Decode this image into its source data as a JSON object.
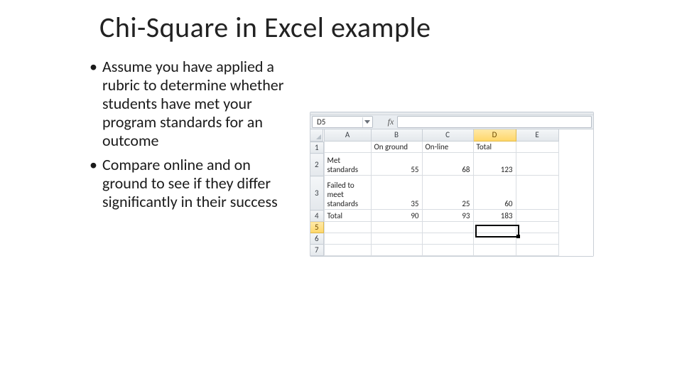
{
  "title": "Chi-Square in Excel example",
  "bullets": [
    "Assume you have applied a rubric to determine whether students have met your program standards for an outcome",
    "Compare online and on ground to see if they differ significantly in their success"
  ],
  "excel": {
    "namebox_value": "D5",
    "fx_label": "fx",
    "columns": [
      "A",
      "B",
      "C",
      "D",
      "E"
    ],
    "row_numbers": [
      "1",
      "2",
      "3",
      "4",
      "5",
      "6",
      "7"
    ],
    "headers_row": {
      "A": "",
      "B": "On ground",
      "C": "On-line",
      "D": "Total",
      "E": ""
    },
    "data_rows": [
      {
        "A": "Met standards",
        "B": "55",
        "C": "68",
        "D": "123",
        "E": ""
      },
      {
        "A": "Failed to meet standards",
        "B": "35",
        "C": "25",
        "D": "60",
        "E": ""
      },
      {
        "A": "Total",
        "B": "90",
        "C": "93",
        "D": "183",
        "E": ""
      }
    ],
    "selected_cell": "D5"
  },
  "chart_data": {
    "type": "table",
    "title": "Chi-Square in Excel example",
    "columns": [
      "",
      "On ground",
      "On-line",
      "Total"
    ],
    "rows": [
      [
        "Met standards",
        55,
        68,
        123
      ],
      [
        "Failed to meet standards",
        35,
        25,
        60
      ],
      [
        "Total",
        90,
        93,
        183
      ]
    ]
  }
}
